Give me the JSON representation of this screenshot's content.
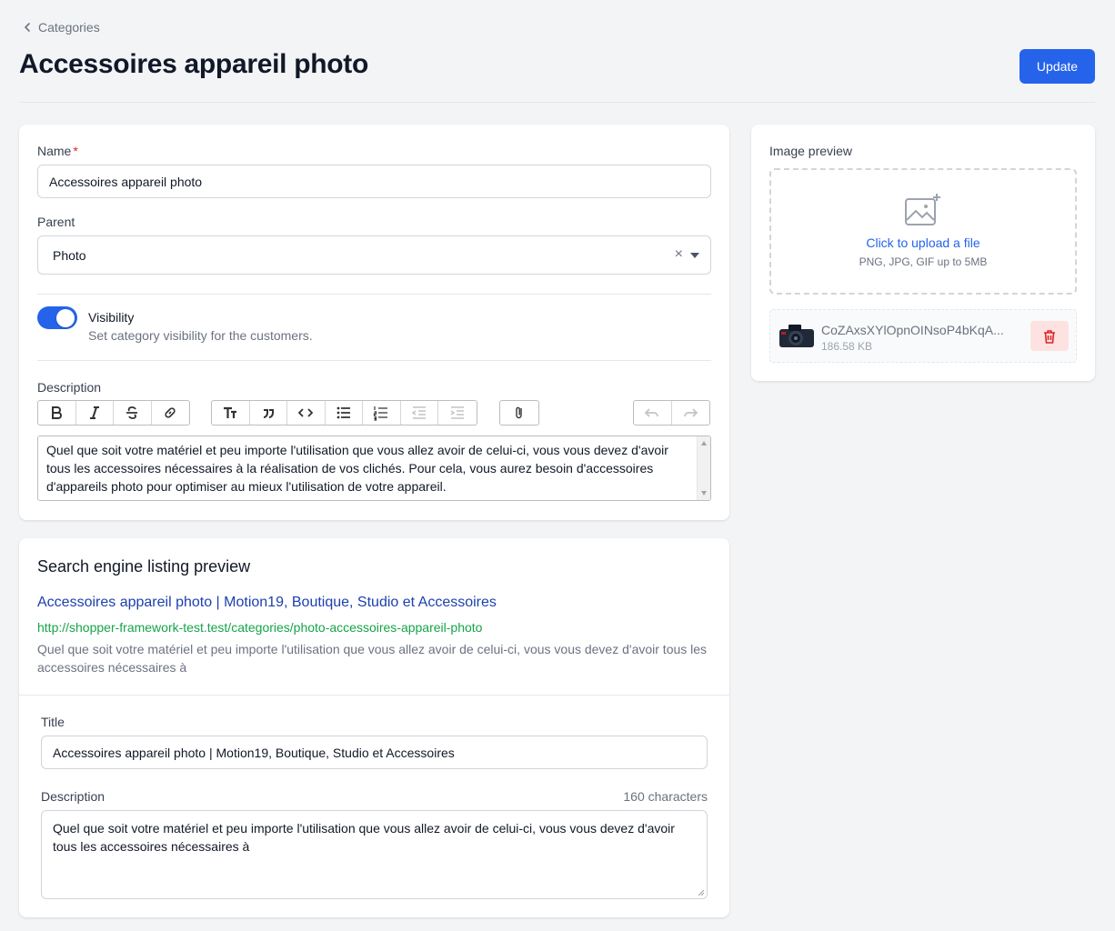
{
  "breadcrumb": {
    "label": "Categories"
  },
  "page": {
    "title": "Accessoires appareil photo",
    "update_label": "Update"
  },
  "form": {
    "name_label": "Name",
    "name_required": "*",
    "name_value": "Accessoires appareil photo",
    "parent_label": "Parent",
    "parent_value": "Photo",
    "parent_clear": "×",
    "visibility_title": "Visibility",
    "visibility_help": "Set category visibility for the customers.",
    "visibility_on": true,
    "description_label": "Description",
    "description_value": "Quel que soit votre matériel et peu importe l'utilisation que vous allez avoir de celui-ci, vous vous devez d'avoir tous les accessoires nécessaires à la réalisation de vos clichés. Pour cela, vous aurez besoin d'accessoires d'appareils photo pour optimiser au mieux l'utilisation de votre appareil.",
    "toolbar_groups": [
      [
        "bold-icon",
        "italic-icon",
        "strikethrough-icon",
        "link-icon"
      ],
      [
        "heading-icon",
        "quote-icon",
        "code-icon",
        "bullet-list-icon",
        "numbered-list-icon",
        "outdent-icon",
        "indent-icon"
      ],
      [
        "attach-icon"
      ],
      [
        "undo-icon",
        "redo-icon"
      ]
    ]
  },
  "seo": {
    "heading": "Search engine listing preview",
    "preview_title": "Accessoires appareil photo | Motion19, Boutique, Studio et Accessoires",
    "preview_url": "http://shopper-framework-test.test/categories/photo-accessoires-appareil-photo",
    "preview_description": "Quel que soit votre matériel et peu importe l'utilisation que vous allez avoir de celui-ci, vous vous devez d'avoir tous les accessoires nécessaires à",
    "title_label": "Title",
    "title_value": "Accessoires appareil photo | Motion19, Boutique, Studio et Accessoires",
    "description_label": "Description",
    "char_count": "160 characters",
    "description_value": "Quel que soit votre matériel et peu importe l'utilisation que vous allez avoir de celui-ci, vous vous devez d'avoir tous les accessoires nécessaires à"
  },
  "image": {
    "label": "Image preview",
    "upload_link": "Click to upload a file",
    "upload_help": "PNG, JPG, GIF up to 5MB",
    "file_name": "CoZAxsXYlOpnOINsoP4bKqA...",
    "file_size": "186.58 KB"
  },
  "colors": {
    "primary": "#2563eb",
    "danger_bg": "#fee2e2",
    "danger": "#dc2626",
    "url_green": "#16a34a",
    "link_blue": "#1e40af"
  }
}
